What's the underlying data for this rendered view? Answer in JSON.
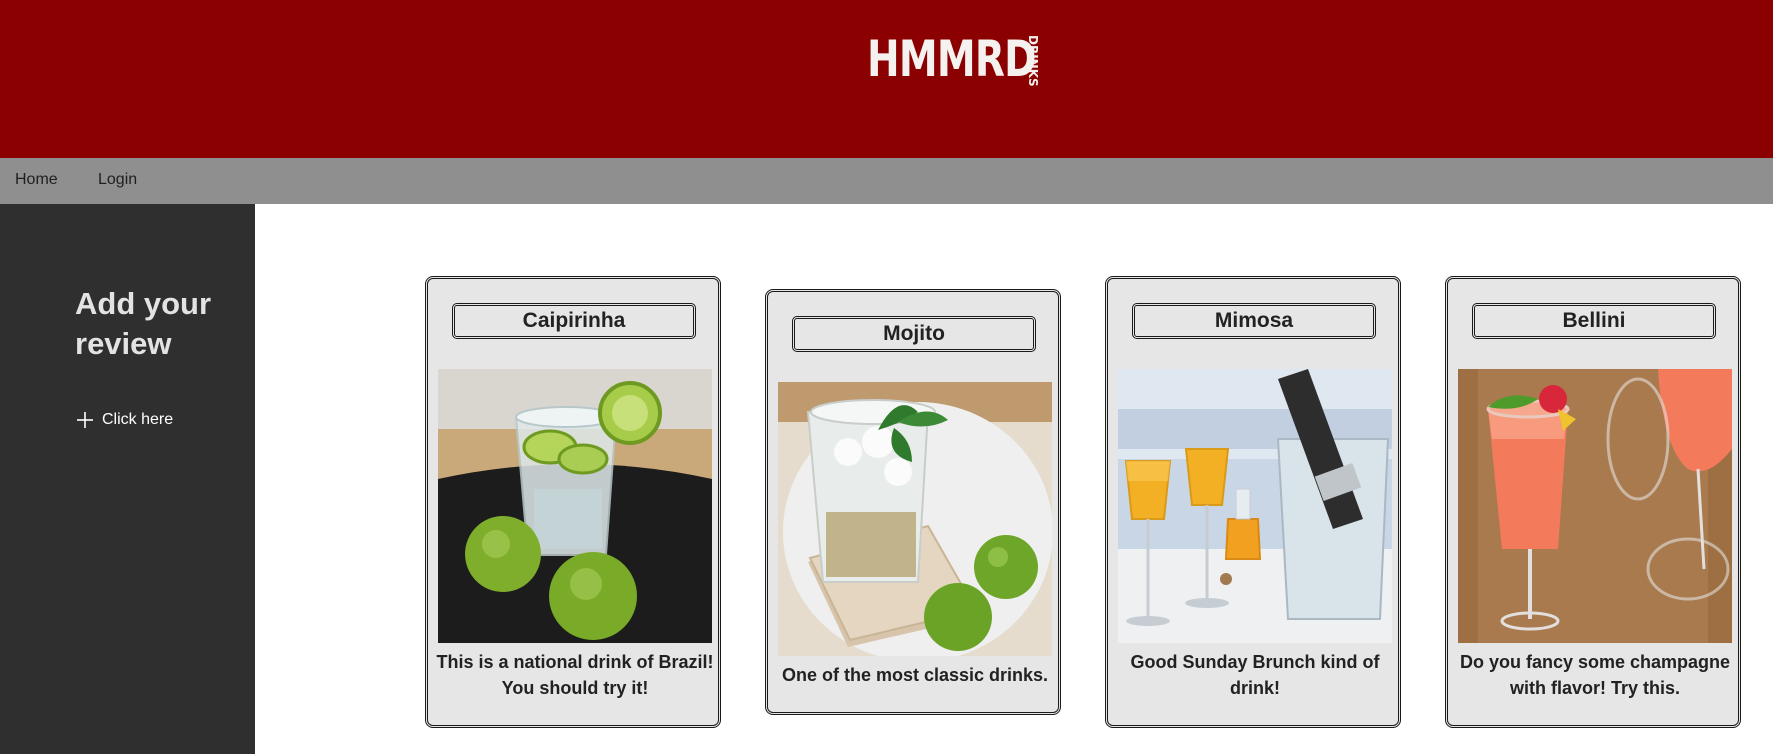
{
  "brand": {
    "logo_main": "HMMRD",
    "logo_sub": "DRINKS"
  },
  "nav": {
    "items": [
      {
        "label": "Home"
      },
      {
        "label": "Login"
      }
    ]
  },
  "sidebar": {
    "title": "Add your review",
    "link_label": "Click here",
    "link_icon": "plus-icon"
  },
  "colors": {
    "header": "#8b0000",
    "navbar": "#8f8f8f",
    "sidebar": "#2f2f2f",
    "card": "#e6e6e6"
  },
  "drinks": [
    {
      "name": "Caipirinha",
      "description": "This is a national drink of Brazil! You should try it!"
    },
    {
      "name": "Mojito",
      "description": "One of the most classic drinks."
    },
    {
      "name": "Mimosa",
      "description": "Good Sunday Brunch kind of drink!"
    },
    {
      "name": "Bellini",
      "description": "Do you fancy some champagne with flavor! Try this."
    }
  ]
}
